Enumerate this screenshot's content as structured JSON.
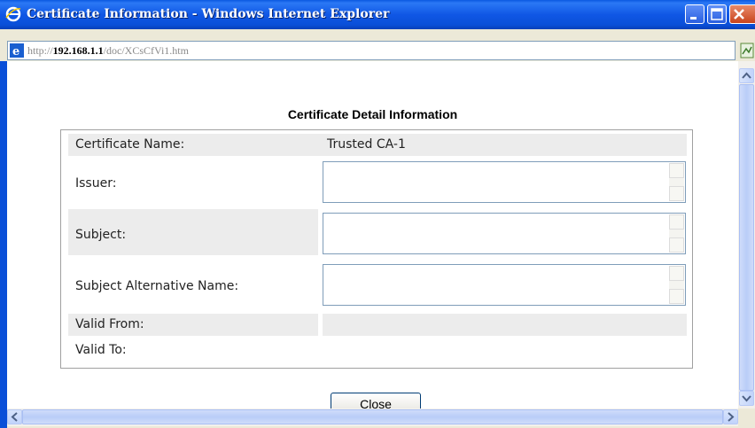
{
  "window": {
    "title": "Certificate Information - Windows Internet Explorer",
    "url_prefix": "http://",
    "url_host": "192.168.1.1",
    "url_path": "/doc/XCsCfVi1.htm"
  },
  "page": {
    "heading": "Certificate Detail Information",
    "fields": {
      "certificate_name_label": "Certificate Name:",
      "certificate_name_value": "Trusted CA-1",
      "issuer_label": "Issuer:",
      "issuer_value": "",
      "subject_label": "Subject:",
      "subject_value": "",
      "subject_alt_label": "Subject Alternative Name:",
      "subject_alt_value": "",
      "valid_from_label": "Valid From:",
      "valid_from_value": "",
      "valid_to_label": "Valid To:",
      "valid_to_value": ""
    },
    "close_label": "Close"
  },
  "colors": {
    "titlebar": "#0a58e0",
    "row_shade": "#ececec",
    "field_border": "#7f9db9"
  }
}
